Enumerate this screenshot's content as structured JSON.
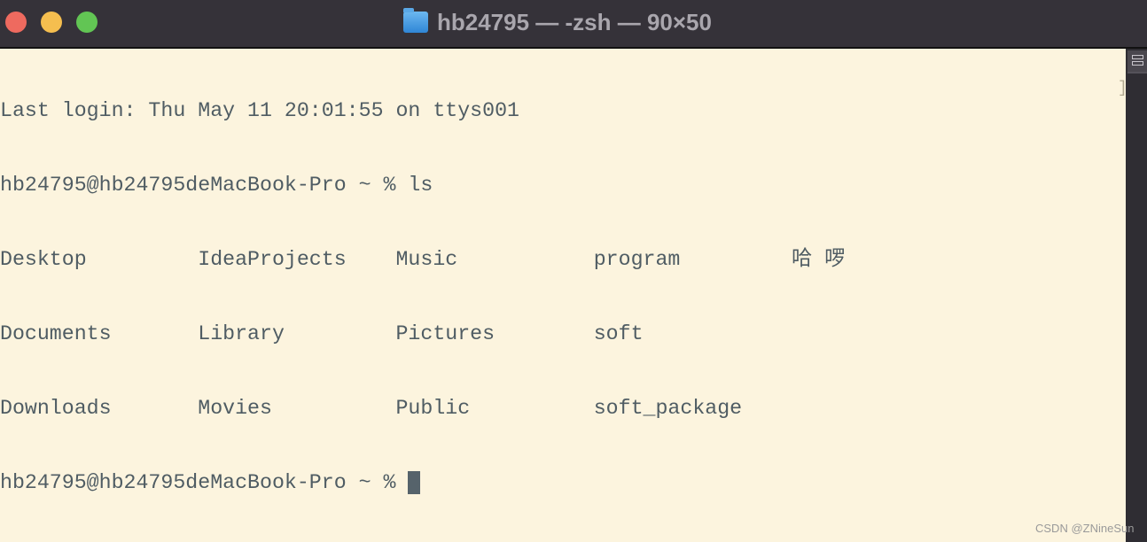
{
  "window": {
    "title": "hb24795 — -zsh — 90×50",
    "icon": "home-folder-icon",
    "traffic_lights": {
      "close": "#ee6a5f",
      "minimize": "#f5be4f",
      "zoom": "#62c554"
    }
  },
  "terminal": {
    "lines": [
      "Last login: Thu May 11 20:01:55 on ttys001",
      "hb24795@hb24795deMacBook-Pro ~ % ls",
      "Desktop         IdeaProjects    Music           program         哈 啰",
      "Documents       Library         Pictures        soft",
      "Downloads       Movies          Public          soft_package"
    ],
    "prompt": "hb24795@hb24795deMacBook-Pro ~ % ",
    "background": "#fcf4de",
    "foreground": "#4f5c63"
  },
  "watermark": "CSDN @ZNineSun"
}
